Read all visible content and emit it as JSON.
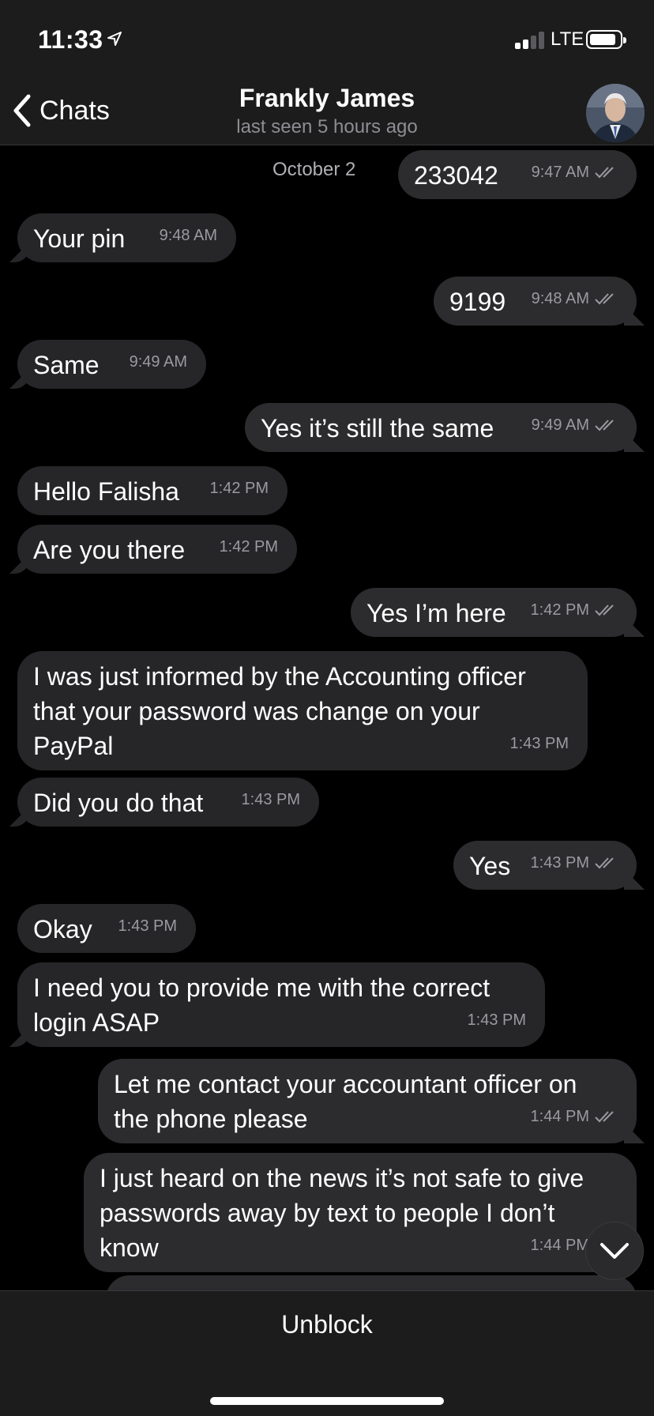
{
  "status_bar": {
    "time": "11:33",
    "network": "LTE",
    "signal_bars_active": 2,
    "signal_bars_total": 4,
    "battery_level": 0.9
  },
  "header": {
    "back_label": "Chats",
    "contact_name": "Frankly James",
    "last_seen": "last seen 5 hours ago"
  },
  "chat": {
    "date_label": "October 2",
    "messages": [
      {
        "direction": "out",
        "text": "233042",
        "time": "9:47 AM",
        "read": true
      },
      {
        "direction": "in",
        "text": "Your pin",
        "time": "9:48 AM"
      },
      {
        "direction": "out",
        "text": "9199",
        "time": "9:48 AM",
        "read": true
      },
      {
        "direction": "in",
        "text": "Same",
        "time": "9:49 AM"
      },
      {
        "direction": "out",
        "text": "Yes it’s still the same",
        "time": "9:49 AM",
        "read": true
      },
      {
        "direction": "in",
        "text": "Hello Falisha",
        "time": "1:42 PM"
      },
      {
        "direction": "in",
        "text": "Are you there",
        "time": "1:42 PM"
      },
      {
        "direction": "out",
        "text": "Yes I’m here",
        "time": "1:42 PM",
        "read": true
      },
      {
        "direction": "in",
        "text": "I was just informed by the Accounting officer that your password was change on your PayPal",
        "time": "1:43 PM"
      },
      {
        "direction": "in",
        "text": "Did you do that",
        "time": "1:43 PM"
      },
      {
        "direction": "out",
        "text": "Yes",
        "time": "1:43 PM",
        "read": true
      },
      {
        "direction": "in",
        "text": "Okay",
        "time": "1:43 PM"
      },
      {
        "direction": "in",
        "text": "I need you to provide me with the correct login ASAP",
        "time": "1:43 PM"
      },
      {
        "direction": "out",
        "text": "Let me contact your accountant officer on the phone please",
        "time": "1:44 PM",
        "read": true
      },
      {
        "direction": "out",
        "text": "I just heard on the news it’s not safe to give passwords away by text to people I don’t know",
        "time": "1:44 PM",
        "read": true
      }
    ]
  },
  "bottom": {
    "unblock_label": "Unblock"
  },
  "icons": {
    "location": "location-arrow-icon",
    "back": "chevron-left-icon",
    "read": "double-check-icon",
    "scroll": "chevron-down-icon"
  },
  "colors": {
    "background": "#000000",
    "bar": "#1c1c1d",
    "bubble": "#262628",
    "meta_text": "#9a9aa0"
  }
}
